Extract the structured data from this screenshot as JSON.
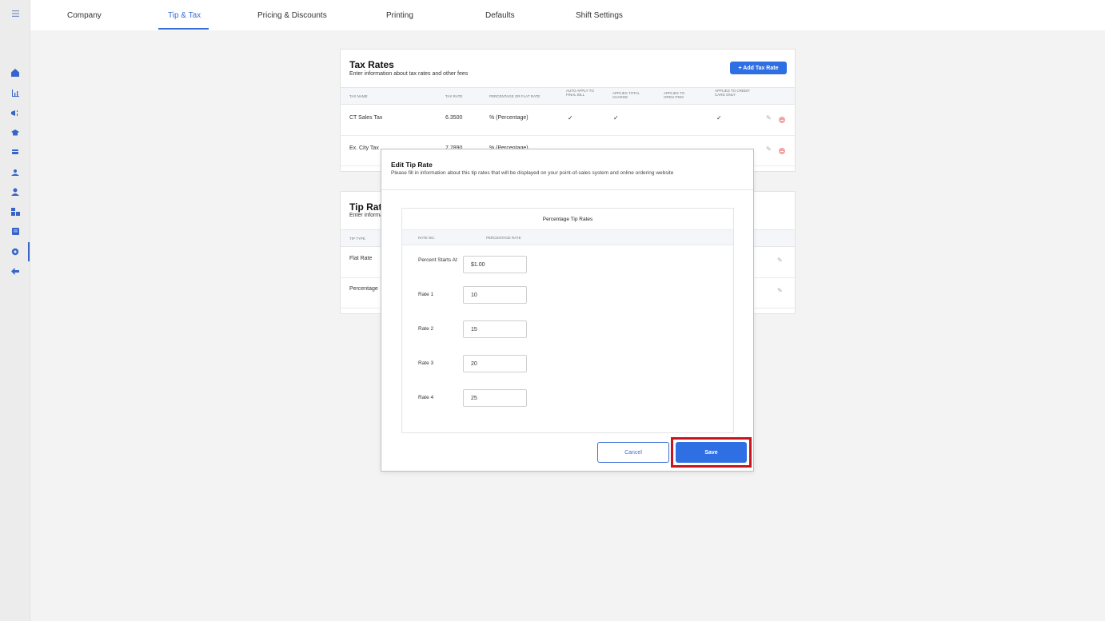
{
  "sidebar": {
    "icons": [
      "menu-icon",
      "home-icon",
      "chart-icon",
      "megaphone-icon",
      "graduation-cap-icon",
      "card-icon",
      "user-group-icon",
      "user-icon",
      "inventory-icon",
      "document-icon",
      "gear-icon",
      "back-arrow-icon"
    ],
    "active": "gear-icon"
  },
  "nav": {
    "tabs": [
      "Company",
      "Tip & Tax",
      "Pricing & Discounts",
      "Printing",
      "Defaults",
      "Shift Settings"
    ],
    "active_tab": "Tip & Tax"
  },
  "tax_rates": {
    "title": "Tax Rates",
    "subtitle": "Enter information about tax rates and other fees",
    "add_button": "+ Add Tax Rate",
    "headers": {
      "name": "TAX NAME",
      "rate": "TAX RATE",
      "type": "PERCENTAGE OR FLAT RATE",
      "auto_apply": "AUTO APPLY TO FINAL BILL",
      "applies_total": "APPLIES TOTAL CHARGE",
      "applies_open": "APPLIES TO OPEN ITEM",
      "applies_credit": "APPLIES TO CREDIT CARD ONLY"
    },
    "rows": [
      {
        "name": "CT Sales Tax",
        "rate": "6.3500",
        "type": "% (Percentage)"
      },
      {
        "name": "Ex. City Tax",
        "rate": "7.7890",
        "type": "% (Percentage)"
      }
    ],
    "check_mark": "✓"
  },
  "tip_rates": {
    "title": "Tip Rates",
    "subtitle": "Enter information",
    "header_type": "TIP TYPE",
    "rows": [
      "Flat Rate",
      "Percentage"
    ]
  },
  "modal": {
    "title": "Edit Tip Rate",
    "subtitle": "Please fill in information about this tip rates that will be displayed on your point-of-sales system and online ordering website",
    "section_title": "Percentage Tip Rates",
    "col_rate_no": "RATE NO.",
    "col_percentage_rate": "PERCENTAGE RATE",
    "rows": [
      {
        "label": "Percent Starts At",
        "value": "$1.00"
      },
      {
        "label": "Rate 1",
        "value": "10"
      },
      {
        "label": "Rate 2",
        "value": "15"
      },
      {
        "label": "Rate 3",
        "value": "20"
      },
      {
        "label": "Rate 4",
        "value": "25"
      }
    ],
    "cancel_label": "Cancel",
    "save_label": "Save"
  },
  "colors": {
    "accent": "#2f6fe4",
    "highlight": "#c8141f"
  }
}
